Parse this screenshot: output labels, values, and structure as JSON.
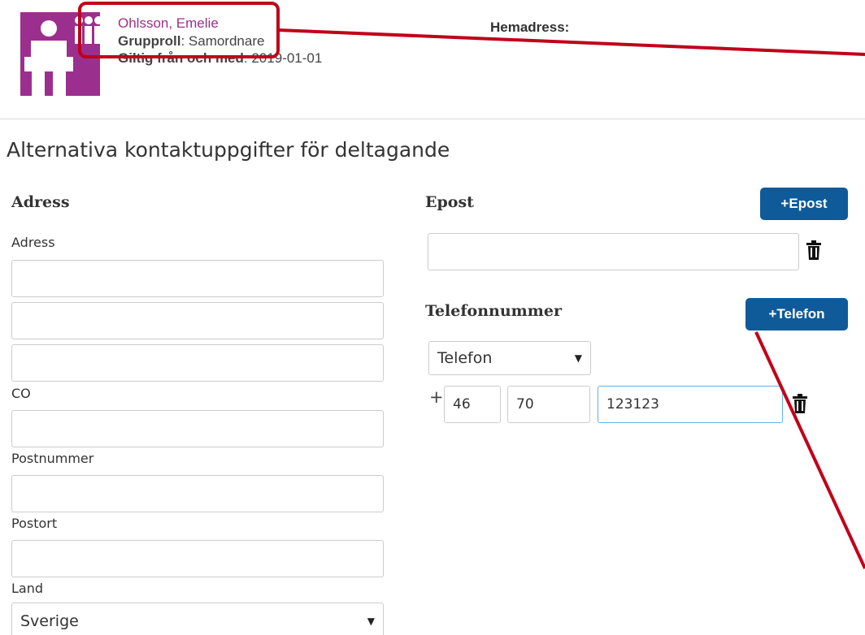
{
  "header": {
    "user_name": "Ohlsson, Emelie",
    "group_role_label": "Grupproll",
    "group_role_value": ": Samordnare",
    "valid_from_label": "Giltig från och med",
    "valid_from_value": ": 2019-01-01",
    "home_address_label": "Hemadress:"
  },
  "section_title": "Alternativa kontaktuppgifter för deltagande",
  "address": {
    "heading": "Adress",
    "address_label": "Adress",
    "address_lines": [
      "",
      "",
      ""
    ],
    "co_label": "CO",
    "co_value": "",
    "postal_code_label": "Postnummer",
    "postal_code_value": "",
    "city_label": "Postort",
    "city_value": "",
    "country_label": "Land",
    "country_value": "Sverige"
  },
  "email": {
    "heading": "Epost",
    "add_button": "+Epost",
    "value": ""
  },
  "phone": {
    "heading": "Telefonnummer",
    "add_button": "+Telefon",
    "type_value": "Telefon",
    "plus": "+",
    "country_code": "46",
    "area_code": "70",
    "number": "123123"
  },
  "colors": {
    "brand_purple": "#9b2f8e",
    "button_blue": "#0f5b9a",
    "annotation_red": "#c0001a"
  },
  "icons": [
    "user-group-icon",
    "trash-icon",
    "chevron-down-icon"
  ]
}
